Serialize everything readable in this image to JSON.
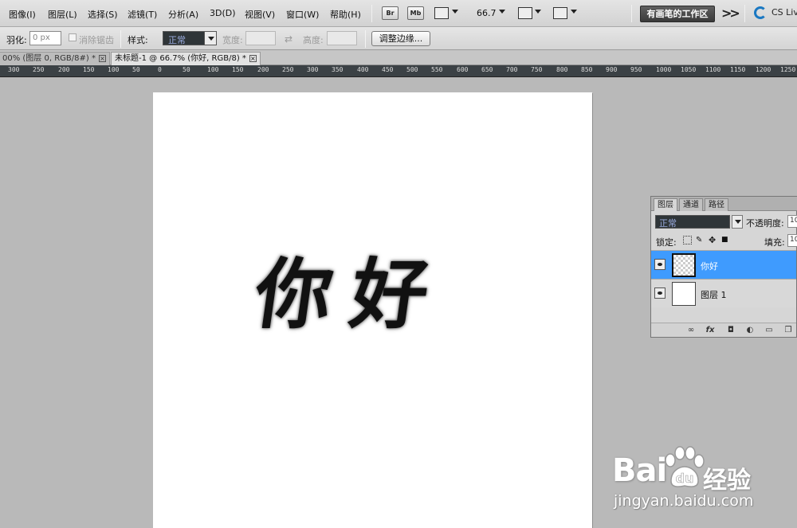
{
  "menubar": {
    "items": [
      "图像(I)",
      "图层(L)",
      "选择(S)",
      "滤镜(T)",
      "分析(A)",
      "3D(D)",
      "视图(V)",
      "窗口(W)",
      "帮助(H)"
    ],
    "bridge_label": "Br",
    "minibridge_label": "Mb",
    "zoom_value": "66.7",
    "workspace_label": "有画笔的工作区",
    "cslive_label": "CS Live"
  },
  "options": {
    "feather_label": "羽化:",
    "feather_value": "0 px",
    "antialias_label": "消除锯齿",
    "style_label": "样式:",
    "style_value": "正常",
    "width_label": "宽度:",
    "height_label": "高度:",
    "refine_edge_label": "调整边缘..."
  },
  "tabs": [
    {
      "label": "00% (图层 0, RGB/8#) *",
      "active": false
    },
    {
      "label": "未标题-1 @ 66.7% (你好, RGB/8) *",
      "active": true
    }
  ],
  "ruler": {
    "ticks": [
      "300",
      "250",
      "200",
      "150",
      "100",
      "50",
      "0",
      "50",
      "100",
      "150",
      "200",
      "250",
      "300",
      "350",
      "400",
      "450",
      "500",
      "550",
      "600",
      "650",
      "700",
      "750",
      "800",
      "850",
      "900",
      "950",
      "1000",
      "1050",
      "1100",
      "1150",
      "1200",
      "1250"
    ]
  },
  "canvas": {
    "text": "你好"
  },
  "layers_panel": {
    "tabs": [
      "图层",
      "通道",
      "路径"
    ],
    "blend_mode": "正常",
    "opacity_label": "不透明度:",
    "opacity_value": "10",
    "lock_label": "锁定:",
    "fill_label": "填充:",
    "fill_value": "10",
    "layers": [
      {
        "name": "你好",
        "selected": true
      },
      {
        "name": "图层 1",
        "selected": false
      }
    ]
  },
  "watermark": {
    "brand": "Bai",
    "brand2": "经验",
    "url": "jingyan.baidu.com"
  },
  "colors": {
    "selection": "#3f9bfe",
    "workspace_bg": "#b9b9b9",
    "cslive_icon": "#1a78c2"
  }
}
